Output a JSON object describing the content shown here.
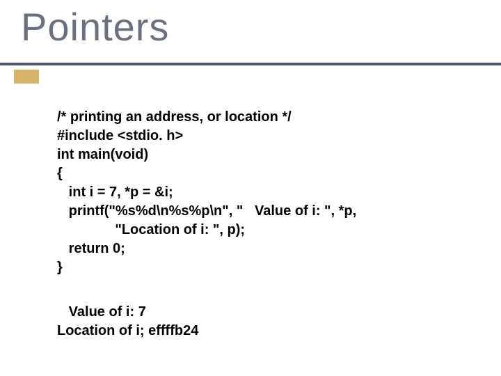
{
  "title": "Pointers",
  "code": {
    "l1": "/* printing an address, or location */",
    "l2": "#include <stdio. h>",
    "l3": "int main(void)",
    "l4": "{",
    "l5": "   int i = 7, *p = &i;",
    "l6": "   printf(\"%s%d\\n%s%p\\n\", \"   Value of i: \", *p,",
    "l7": "               \"Location of i: \", p);",
    "l8": "   return 0;",
    "l9": "}"
  },
  "output": {
    "l1": "   Value of i: 7",
    "l2": "Location of i; effffb24"
  }
}
